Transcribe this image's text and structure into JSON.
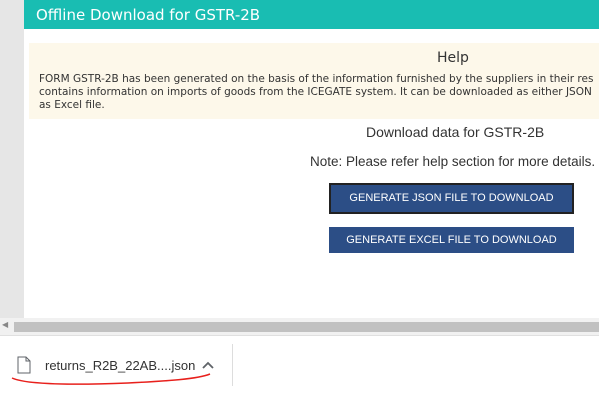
{
  "header": {
    "title": "Offline Download for GSTR-2B"
  },
  "help": {
    "title": "Help",
    "lines": [
      "FORM GSTR-2B has been generated on the basis of the information furnished by the suppliers in their res",
      "contains information on imports of goods from the ICEGATE system. It can be downloaded as either JSON",
      "as Excel file."
    ]
  },
  "main": {
    "download_title": "Download data for GSTR-2B",
    "note": "Note: Please refer help section for more details.",
    "json_button": "GENERATE JSON FILE TO DOWNLOAD",
    "excel_button": "GENERATE EXCEL FILE TO DOWNLOAD"
  },
  "download_bar": {
    "file_name": "returns_R2B_22AB....json",
    "file_icon": "file-icon",
    "chevron_icon": "chevron-up-icon"
  },
  "colors": {
    "header": "#19bdb2",
    "button": "#2c4e86",
    "help_bg": "#fdf8ea",
    "annotation": "#e8201c"
  }
}
